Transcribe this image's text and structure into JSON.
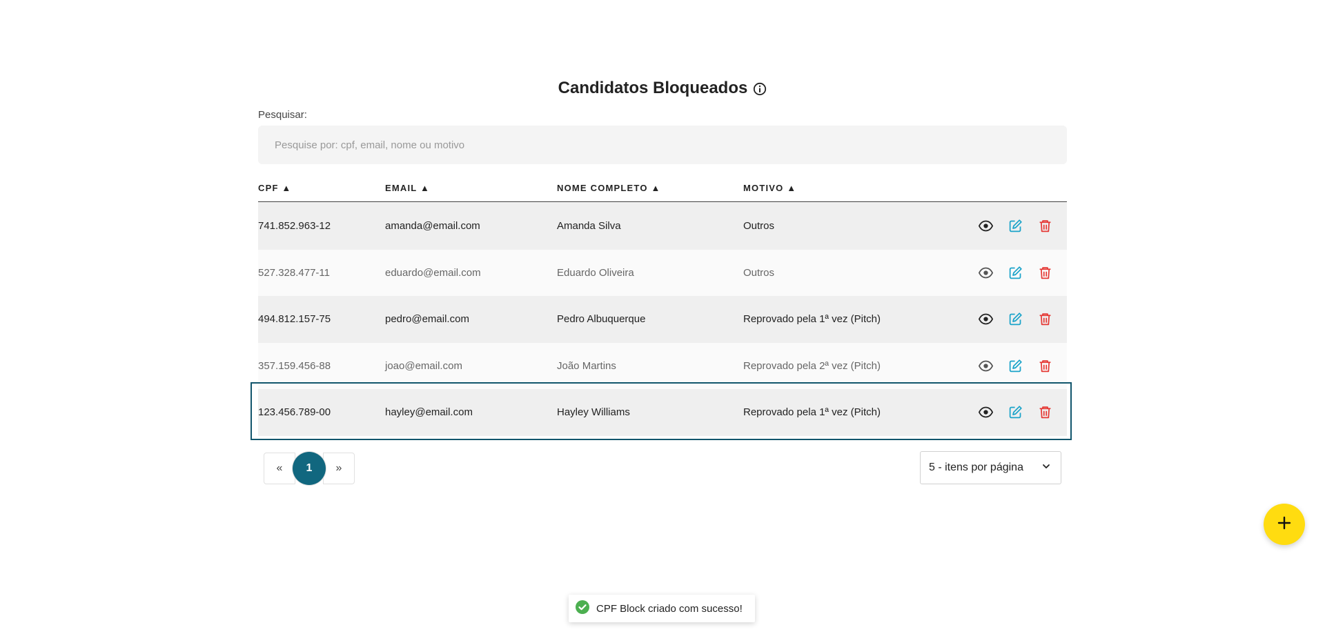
{
  "page": {
    "title": "Candidatos Bloqueados",
    "info_icon": "info-circle-icon"
  },
  "search": {
    "label": "Pesquisar:",
    "placeholder": "Pesquise por: cpf, email, nome ou motivo",
    "value": ""
  },
  "table": {
    "headers": {
      "cpf": "CPF ▲",
      "email": "EMAIL ▲",
      "nome": "NOME COMPLETO ▲",
      "motivo": "MOTIVO ▲"
    },
    "rows": [
      {
        "cpf": "741.852.963-12",
        "email": "amanda@email.com",
        "nome": "Amanda Silva",
        "motivo": "Outros"
      },
      {
        "cpf": "527.328.477-11",
        "email": "eduardo@email.com",
        "nome": "Eduardo Oliveira",
        "motivo": "Outros"
      },
      {
        "cpf": "494.812.157-75",
        "email": "pedro@email.com",
        "nome": "Pedro Albuquerque",
        "motivo": "Reprovado pela 1ª vez (Pitch)"
      },
      {
        "cpf": "357.159.456-88",
        "email": "joao@email.com",
        "nome": "João Martins",
        "motivo": "Reprovado pela 2ª vez (Pitch)"
      },
      {
        "cpf": "123.456.789-00",
        "email": "hayley@email.com",
        "nome": "Hayley Williams",
        "motivo": "Reprovado pela 1ª vez (Pitch)"
      }
    ],
    "row_actions": [
      "eye-icon",
      "edit-icon",
      "trash-icon"
    ],
    "highlighted_row_index": 4
  },
  "pagination": {
    "prev": "«",
    "current": "1",
    "next": "»",
    "per_page": "5 - itens por página"
  },
  "fab": {
    "icon": "plus-icon"
  },
  "toast": {
    "message": "CPF Block criado com sucesso!",
    "icon": "check-circle-icon"
  },
  "colors": {
    "primary": "#11677f",
    "highlight_border": "#11556c",
    "edit": "#1aa3c9",
    "delete": "#e53935",
    "fab": "#ffdc10",
    "success": "#4caf50"
  }
}
